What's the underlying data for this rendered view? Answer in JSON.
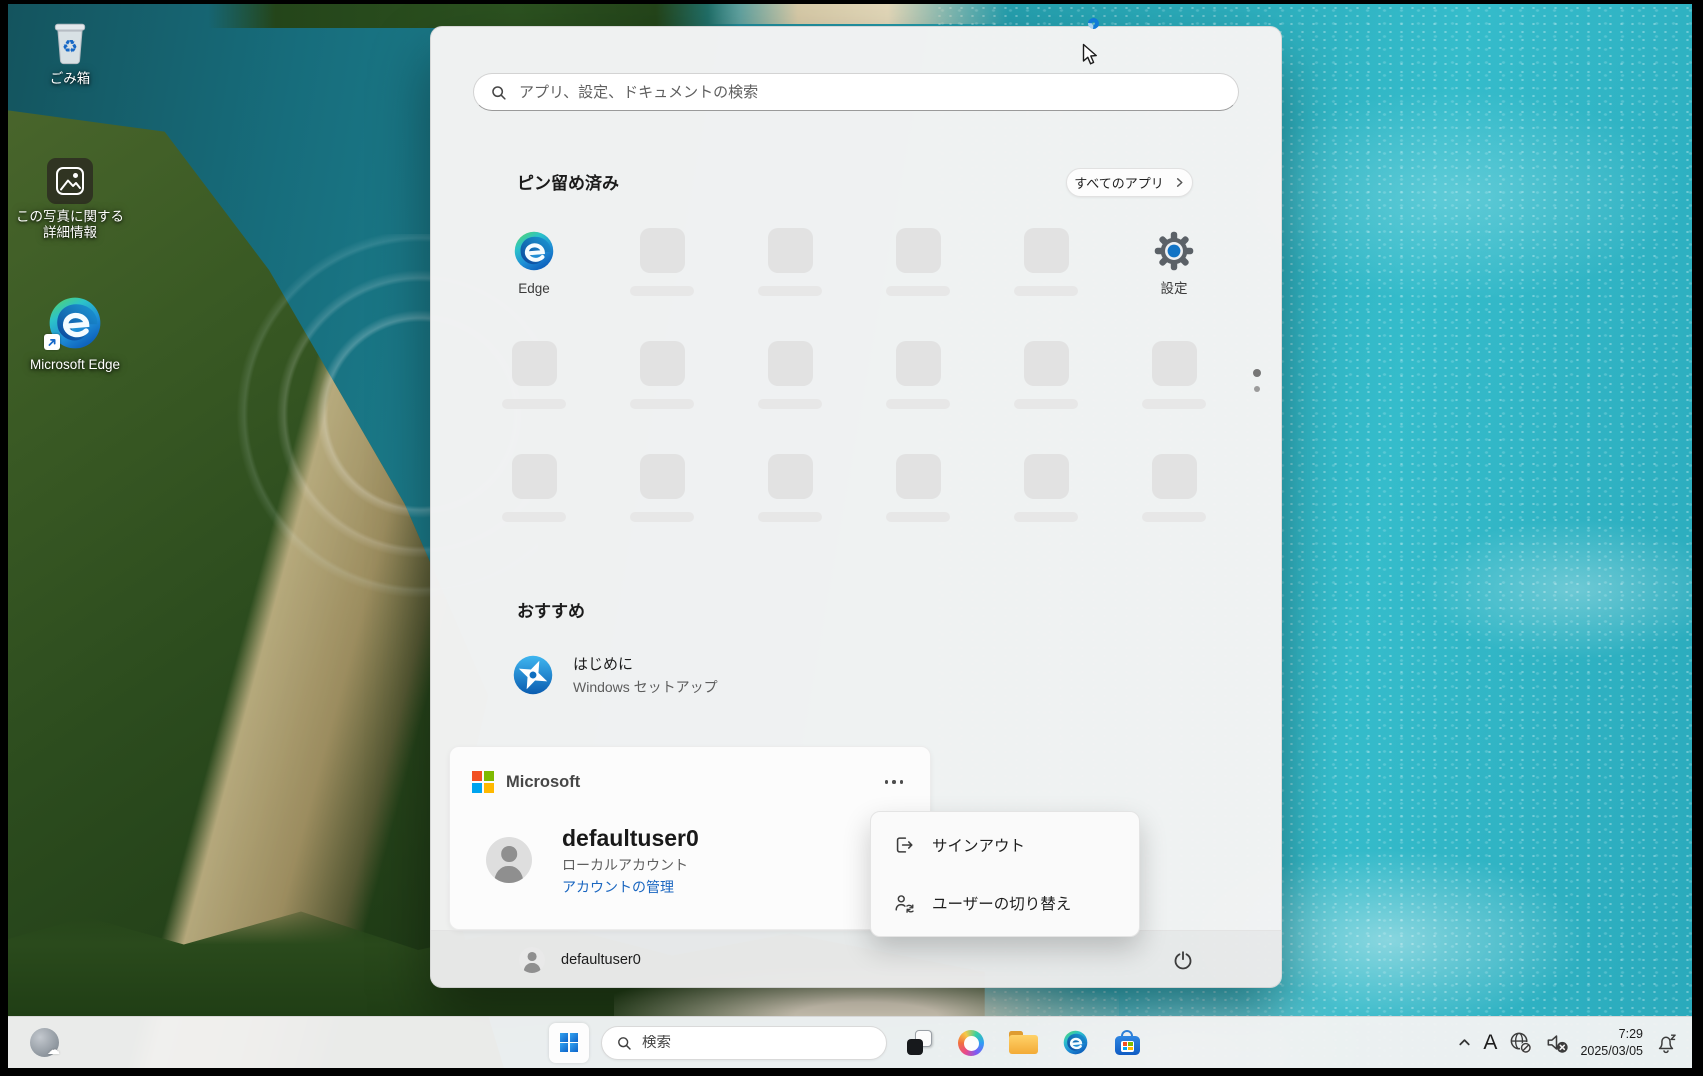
{
  "desktop": {
    "icons": [
      {
        "name": "recycle-bin",
        "label": "ごみ箱"
      },
      {
        "name": "photo-info",
        "label": "この写真に関する詳細情報"
      },
      {
        "name": "microsoft-edge",
        "label": "Microsoft Edge"
      }
    ]
  },
  "start_menu": {
    "search": {
      "placeholder": "アプリ、設定、ドキュメントの検索"
    },
    "pinned": {
      "title": "ピン留め済み",
      "all_apps_button": "すべてのアプリ",
      "apps": [
        {
          "label": "Edge"
        },
        {
          "label": "設定"
        }
      ],
      "placeholder_tiles": 16
    },
    "recommended": {
      "title": "おすすめ",
      "items": [
        {
          "title": "はじめに",
          "subtitle": "Windows セットアップ"
        }
      ]
    },
    "account_card": {
      "brand": "Microsoft",
      "user_name": "defaultuser0",
      "account_type": "ローカルアカウント",
      "manage_account_link": "アカウントの管理"
    },
    "account_menu": {
      "items": [
        {
          "label": "サインアウト"
        },
        {
          "label": "ユーザーの切り替え"
        }
      ]
    },
    "footer": {
      "user_name": "defaultuser0"
    }
  },
  "taskbar": {
    "search_label": "検索",
    "tray": {
      "ime_indicator": "A",
      "time": "7:29",
      "date": "2025/03/05"
    }
  },
  "colors": {
    "accent_blue": "#0078d4",
    "link_blue": "#1a66c0",
    "menu_bg": "#f3f3f3",
    "taskbar_bg": "#f3f3f3",
    "ms_logo_red": "#f25022",
    "ms_logo_green": "#7fba00",
    "ms_logo_blue": "#00a4ef",
    "ms_logo_yellow": "#ffb900"
  }
}
